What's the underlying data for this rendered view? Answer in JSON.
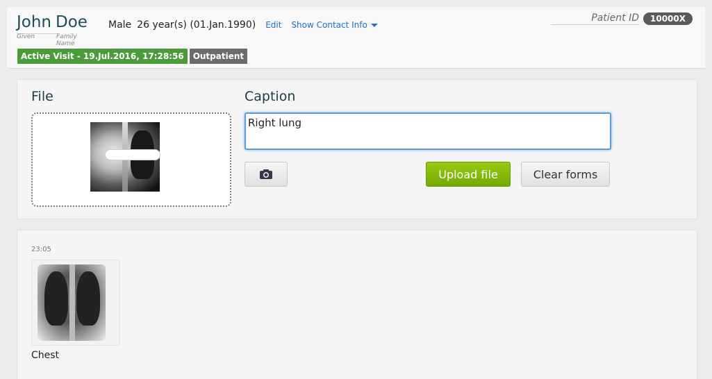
{
  "patient": {
    "given_name": "John",
    "family_name": "Doe",
    "given_label": "Given",
    "family_label": "Family Name",
    "gender": "Male",
    "age_dob": "26 year(s) (01.Jan.1990)",
    "edit_label": "Edit",
    "contact_label": "Show Contact Info",
    "id_label": "Patient ID",
    "id_value": "10000X"
  },
  "visit": {
    "active_label": "Active Visit - 19.Jul.2016, 17:28:56",
    "type_label": "Outpatient"
  },
  "upload": {
    "file_heading": "File",
    "caption_heading": "Caption",
    "caption_value": "Right lung",
    "upload_label": "Upload file",
    "clear_label": "Clear forms"
  },
  "gallery": {
    "items": [
      {
        "time": "23:05",
        "caption": "Chest"
      }
    ]
  },
  "colors": {
    "accent_green": "#74a903",
    "active_badge": "#4b9b3c",
    "link_blue": "#1a73c7"
  },
  "icons": {
    "camera": "camera-icon",
    "caret": "caret-down-icon"
  }
}
